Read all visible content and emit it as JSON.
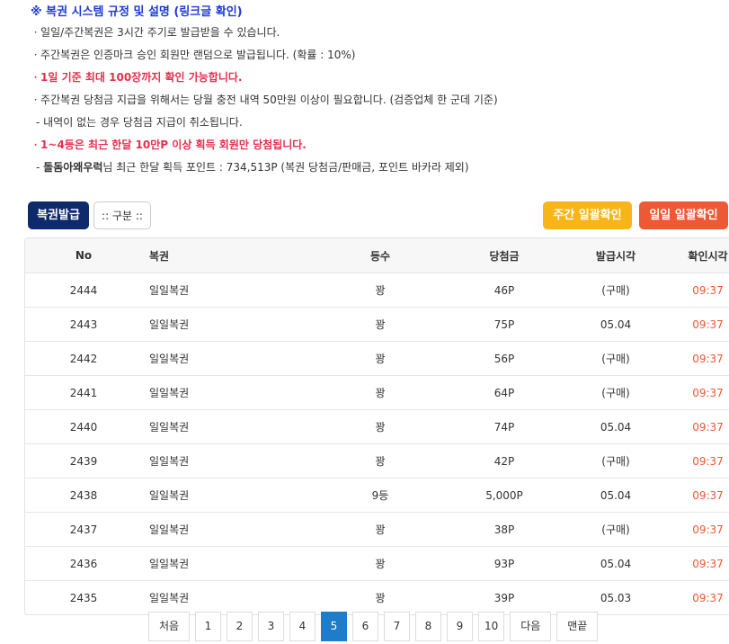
{
  "rules": {
    "title": "※ 복권 시스템 규정 및 설명 (링크글 확인)",
    "lines": [
      {
        "text": "ㆍ일일/주간복권은 3시간 주기로 발급받을 수 있습니다.",
        "style": "normal"
      },
      {
        "text": "ㆍ주간복권은 인증마크 승인 회원만 랜덤으로 발급됩니다. (확률 : 10%)",
        "style": "normal"
      },
      {
        "text": "ㆍ1일 기준 최대 100장까지 확인 가능합니다.",
        "style": "red"
      },
      {
        "text": "ㆍ주간복권 당첨금 지급을 위해서는 당월 충전 내역 50만원 이상이 필요합니다. (검증업체 한 군데 기준)",
        "style": "normal"
      },
      {
        "text": "- 내역이 없는 경우 당첨금 지급이 취소됩니다.",
        "style": "dash"
      },
      {
        "text": "ㆍ1~4등은 최근 한달 10만P 이상 획득 회원만 당첨됩니다.",
        "style": "red"
      }
    ],
    "last_prefix": "- ",
    "last_user": "돌돔아왜우럭",
    "last_suffix": "님 최근 한달 획득 포인트 : 734,513P (복권 당첨금/판매금, 포인트 바카라 제외)"
  },
  "buttons": {
    "issue": "복권발급",
    "category": ":: 구분 ::",
    "weekly_check": "주간 일괄확인",
    "daily_check": "일일 일괄확인"
  },
  "table": {
    "headers": [
      "No",
      "복권",
      "등수",
      "당첨금",
      "발급시각",
      "확인시각"
    ],
    "rows": [
      [
        "2444",
        "일일복권",
        "꽝",
        "46P",
        "(구매)",
        "09:37"
      ],
      [
        "2443",
        "일일복권",
        "꽝",
        "75P",
        "05.04",
        "09:37"
      ],
      [
        "2442",
        "일일복권",
        "꽝",
        "56P",
        "(구매)",
        "09:37"
      ],
      [
        "2441",
        "일일복권",
        "꽝",
        "64P",
        "(구매)",
        "09:37"
      ],
      [
        "2440",
        "일일복권",
        "꽝",
        "74P",
        "05.04",
        "09:37"
      ],
      [
        "2439",
        "일일복권",
        "꽝",
        "42P",
        "(구매)",
        "09:37"
      ],
      [
        "2438",
        "일일복권",
        "9등",
        "5,000P",
        "05.04",
        "09:37"
      ],
      [
        "2437",
        "일일복권",
        "꽝",
        "38P",
        "(구매)",
        "09:37"
      ],
      [
        "2436",
        "일일복권",
        "꽝",
        "93P",
        "05.04",
        "09:37"
      ],
      [
        "2435",
        "일일복권",
        "꽝",
        "39P",
        "05.03",
        "09:37"
      ]
    ]
  },
  "pagination": {
    "first": "처음",
    "pages": [
      "1",
      "2",
      "3",
      "4",
      "5",
      "6",
      "7",
      "8",
      "9",
      "10"
    ],
    "active": "5",
    "next": "다음",
    "last": "맨끝"
  },
  "colors": {
    "title_blue": "#1d3bd6",
    "red_text": "#e5304e",
    "issue_button": "#0f2a6b",
    "weekly_button": "#f7b51a",
    "daily_button": "#ee5834",
    "check_time": "#ee5834",
    "active_page": "#1e7cc8"
  }
}
